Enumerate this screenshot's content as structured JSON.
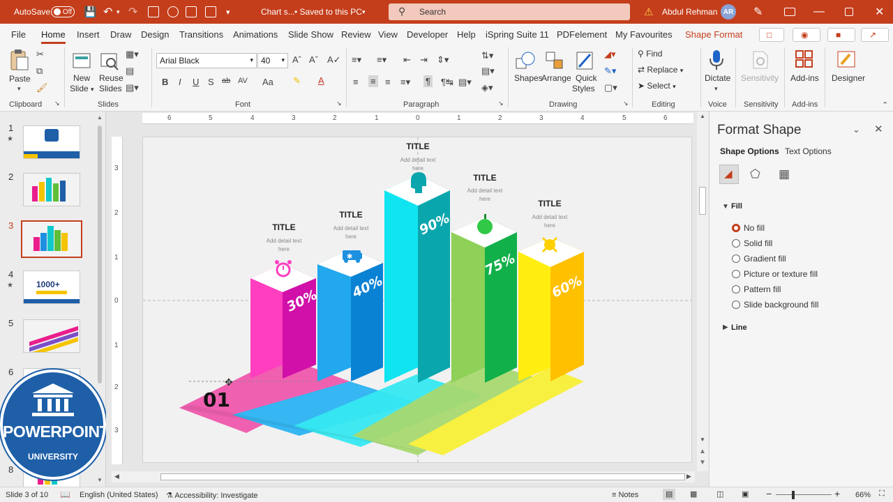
{
  "titlebar": {
    "autosave_label": "AutoSave",
    "autosave_state": "Off",
    "doc_title": "Chart s...",
    "saved_status": "•  Saved to this PC",
    "search_placeholder": "Search",
    "user_name": "Abdul Rehman",
    "user_initials": "AR"
  },
  "menu": {
    "tabs": [
      "File",
      "Home",
      "Insert",
      "Draw",
      "Design",
      "Transitions",
      "Animations",
      "Slide Show",
      "Review",
      "View",
      "Developer",
      "Help",
      "iSpring Suite 11",
      "PDFelement",
      "My Favourites",
      "Shape Format"
    ],
    "active": "Home"
  },
  "ribbon": {
    "clipboard": {
      "paste": "Paste",
      "label": "Clipboard"
    },
    "slides": {
      "new_slide": "New\nSlide",
      "new_slide_l1": "New",
      "new_slide_l2": "Slide",
      "reuse_l1": "Reuse",
      "reuse_l2": "Slides",
      "label": "Slides"
    },
    "font": {
      "name": "Arial Black",
      "size": "40",
      "label": "Font",
      "bold": "B",
      "italic": "I",
      "underline": "U",
      "strike": "ab",
      "spacing": "AV",
      "case": "Aa"
    },
    "paragraph": {
      "label": "Paragraph"
    },
    "drawing": {
      "shapes": "Shapes",
      "arrange": "Arrange",
      "quick_l1": "Quick",
      "quick_l2": "Styles",
      "label": "Drawing"
    },
    "editing": {
      "find": "Find",
      "replace": "Replace",
      "select": "Select",
      "label": "Editing"
    },
    "voice": {
      "dictate": "Dictate",
      "label": "Voice"
    },
    "sensitivity": {
      "button": "Sensitivity",
      "label": "Sensitivity"
    },
    "addins": {
      "button": "Add-ins",
      "label": "Add-ins"
    },
    "designer": {
      "button": "Designer"
    }
  },
  "thumbnails": [
    {
      "num": "1",
      "star": "★"
    },
    {
      "num": "2",
      "star": ""
    },
    {
      "num": "3",
      "star": ""
    },
    {
      "num": "4",
      "star": "★"
    },
    {
      "num": "5",
      "star": ""
    },
    {
      "num": "6",
      "star": ""
    },
    {
      "num": "8",
      "star": ""
    }
  ],
  "thumb4_text": "1000+",
  "logo": {
    "title": "POWERPOINT",
    "subtitle": "UNIVERSITY"
  },
  "ruler": {
    "h": [
      "6",
      "5",
      "4",
      "3",
      "2",
      "1",
      "0",
      "1",
      "2",
      "3",
      "4",
      "5",
      "6"
    ],
    "v": [
      "3",
      "2",
      "1",
      "0",
      "1",
      "2",
      "3"
    ]
  },
  "slide": {
    "big_label": "01",
    "bars": [
      {
        "title": "TITLE",
        "detail_l1": "Add detail text",
        "detail_l2": "here",
        "percent": "30%",
        "color": "#e91e8c",
        "icon": "alarm-clock-icon"
      },
      {
        "title": "TITLE",
        "detail_l1": "Add detail text",
        "detail_l2": "here",
        "percent": "40%",
        "color": "#1e90e0",
        "icon": "ambulance-icon"
      },
      {
        "title": "TITLE",
        "detail_l1": "Add detail text",
        "detail_l2": "here",
        "percent": "90%",
        "color": "#12c8c8",
        "icon": "head-gear-icon"
      },
      {
        "title": "TITLE",
        "detail_l1": "Add detail text",
        "detail_l2": "here",
        "percent": "75%",
        "color": "#5fbf3a",
        "icon": "apple-icon"
      },
      {
        "title": "TITLE",
        "detail_l1": "Add detail text",
        "detail_l2": "here",
        "percent": "60%",
        "color": "#f5c400",
        "icon": "virus-icon"
      }
    ]
  },
  "format_pane": {
    "title": "Format Shape",
    "tab_shape": "Shape Options",
    "tab_text": "Text Options",
    "fill_section": "Fill",
    "fill_options": [
      "No fill",
      "Solid fill",
      "Gradient fill",
      "Picture or texture fill",
      "Pattern fill",
      "Slide background fill"
    ],
    "selected_fill": "No fill",
    "line_section": "Line"
  },
  "status": {
    "slide_info": "Slide 3 of 10",
    "language": "English (United States)",
    "accessibility": "Accessibility: Investigate",
    "notes": "Notes",
    "zoom": "66%"
  }
}
